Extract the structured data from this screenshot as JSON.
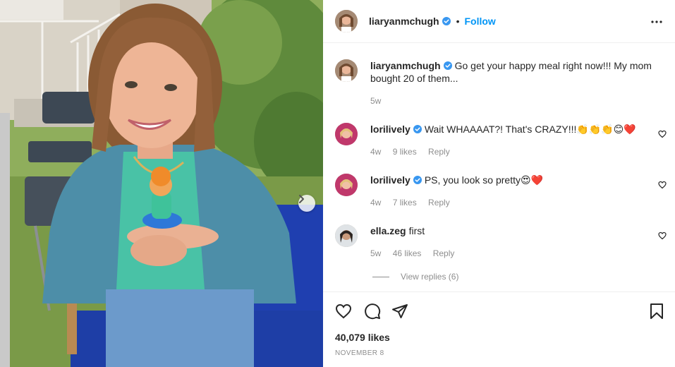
{
  "post": {
    "author": "liaryanmchugh",
    "follow_label": "Follow",
    "dot": "•",
    "caption": {
      "username": "liaryanmchugh",
      "text": "Go get your happy meal right now!!! My mom bought 20 of them...",
      "time": "5w"
    },
    "likes": "40,079 likes",
    "date": "November 8"
  },
  "comments": [
    {
      "username": "lorilively",
      "verified": true,
      "text": "Wait WHAAAAT?! That's CRAZY!!!👏👏👏😊❤️",
      "time": "4w",
      "likes": "9 likes",
      "reply": "Reply"
    },
    {
      "username": "lorilively",
      "verified": true,
      "text": "PS, you look so pretty😍❤️",
      "time": "4w",
      "likes": "7 likes",
      "reply": "Reply"
    },
    {
      "username": "ella.zeg",
      "verified": false,
      "text": "first",
      "time": "5w",
      "likes": "46 likes",
      "reply": "Reply"
    }
  ],
  "view_replies": "View replies (6)",
  "icons": {
    "verified": "verified-badge-icon",
    "more": "more-options-icon",
    "like": "heart-icon",
    "comment": "comment-bubble-icon",
    "share": "paper-plane-icon",
    "save": "bookmark-icon",
    "next": "chevron-right-icon"
  },
  "colors": {
    "accent": "#0095f6",
    "text": "#262626",
    "secondary_text": "#8e8e8e",
    "divider": "#efefef"
  }
}
